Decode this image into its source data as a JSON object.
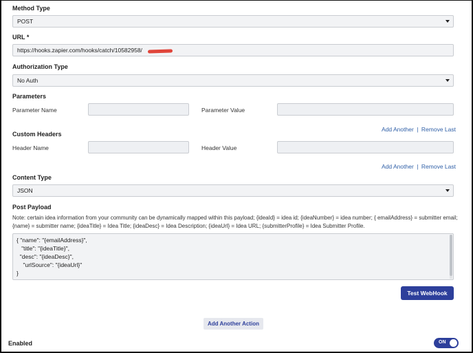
{
  "method": {
    "label": "Method Type",
    "value": "POST"
  },
  "url": {
    "label": "URL *",
    "value": "https://hooks.zapier.com/hooks/catch/10582958/"
  },
  "auth": {
    "label": "Authorization Type",
    "value": "No Auth"
  },
  "parameters": {
    "label": "Parameters",
    "name_label": "Parameter Name",
    "value_label": "Parameter Value",
    "add_link": "Add Another",
    "separator": "|",
    "remove_link": "Remove Last"
  },
  "headers": {
    "label": "Custom Headers",
    "name_label": "Header Name",
    "value_label": "Header Value",
    "add_link": "Add Another",
    "separator": "|",
    "remove_link": "Remove Last"
  },
  "content_type": {
    "label": "Content Type",
    "value": "JSON"
  },
  "payload": {
    "label": "Post Payload",
    "note": "Note: certain idea information from your community can be dynamically mapped within this payload; {ideaId} = idea id; {ideaNumber} = idea number; { emailAddress} = submitter email; {name} = submitter name; {ideaTitle} = Idea Title; {ideaDesc} = Idea Description; {ideaUrl} = Idea URL; {submitterProfile} = Idea Submitter Profile.",
    "lines": [
      "{ \"name\": \"{emailAddress}\",",
      "   \"title\": \"{ideaTitle}\",",
      "  \"desc\": \"{ideaDesc}\",",
      "    \"urlSource\": \"{ideaUrl}\"",
      "}"
    ]
  },
  "buttons": {
    "test_webhook": "Test WebHook",
    "add_action": "Add Another Action"
  },
  "enabled": {
    "label": "Enabled",
    "toggle_text": "ON",
    "on": true
  },
  "colors": {
    "primary": "#2d3f9b",
    "link": "#2f5fa7",
    "field_bg": "#f2f3f5",
    "redaction": "#e0453a"
  }
}
